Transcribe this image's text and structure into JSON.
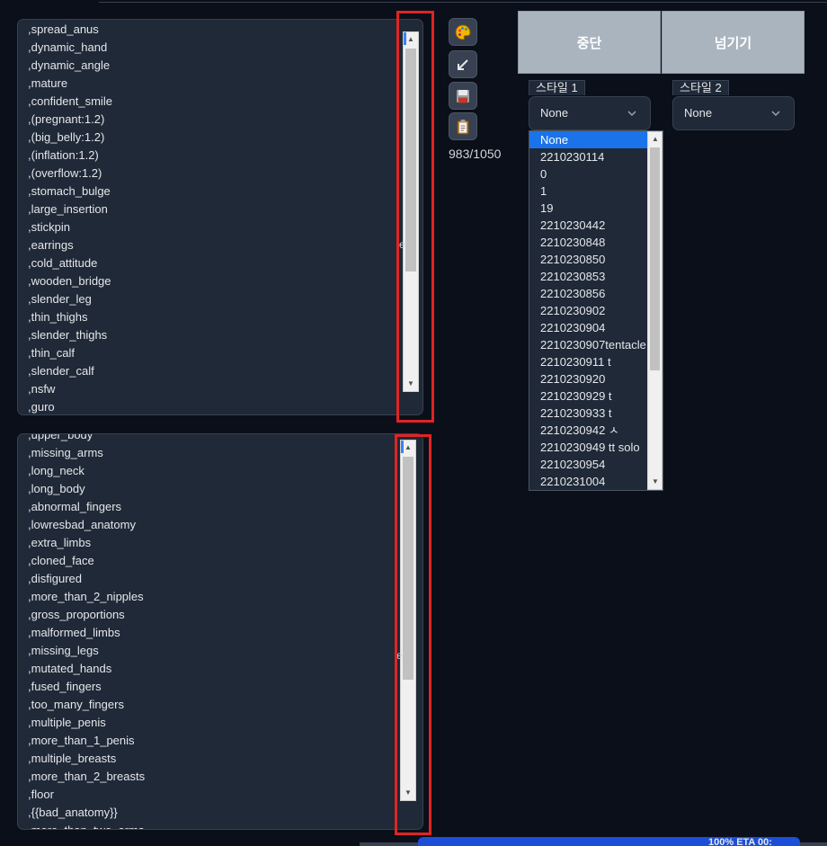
{
  "positive_prompt": {
    "lines": [
      ",spread_anus",
      ",dynamic_hand",
      ",dynamic_angle",
      ",mature",
      ",confident_smile",
      ",(pregnant:1.2)",
      ",(big_belly:1.2)",
      ",(inflation:1.2)",
      ",(overflow:1.2)",
      ",stomach_bulge",
      ",large_insertion",
      ",stickpin",
      ",earrings",
      ",cold_attitude",
      ",wooden_bridge",
      ",slender_leg",
      ",thin_thighs",
      ",slender_thighs",
      ",thin_calf",
      ",slender_calf",
      ",nsfw",
      ",guro"
    ],
    "stray_char": "e"
  },
  "negative_prompt": {
    "lines": [
      ",upper_body",
      ",missing_arms",
      ",long_neck",
      ",long_body",
      ",abnormal_fingers",
      ",lowresbad_anatomy",
      ",extra_limbs",
      ",cloned_face",
      ",disfigured",
      ",more_than_2_nipples",
      ",gross_proportions",
      ",malformed_limbs",
      ",missing_legs",
      ",mutated_hands",
      ",fused_fingers",
      ",too_many_fingers",
      ",multiple_penis",
      ",more_than_1_penis",
      ",multiple_breasts",
      ",more_than_2_breasts",
      ",floor",
      ",{{bad_anatomy}}",
      ",more_than_two_arms"
    ],
    "stray_char": "e"
  },
  "tools": {
    "icons": [
      "palette-icon",
      "arrow-icon",
      "save-icon",
      "clipboard-icon"
    ],
    "token_counter": "983/1050"
  },
  "actions": {
    "interrupt_label": "중단",
    "skip_label": "넘기기"
  },
  "styles": {
    "style1": {
      "label": "스타일 1",
      "value": "None"
    },
    "style2": {
      "label": "스타일 2",
      "value": "None"
    },
    "options": [
      "None",
      "2210230114",
      "0",
      "1",
      "19",
      "2210230442",
      "2210230848",
      "2210230850",
      "2210230853",
      "2210230856",
      "2210230902",
      "2210230904",
      "2210230907tentacle",
      "2210230911 t",
      "2210230920",
      "2210230929 t",
      "2210230933 t",
      "2210230942 ㅅ",
      "2210230949 tt solo",
      "2210230954",
      "2210231004"
    ],
    "selected_index": 0
  },
  "progress": {
    "text": "100% ETA 00:"
  },
  "colors": {
    "background": "#0b0f19",
    "panel": "#1f2937",
    "highlight_box": "#e02424",
    "selection": "#1a73e8",
    "button": "#a9b4bf"
  }
}
